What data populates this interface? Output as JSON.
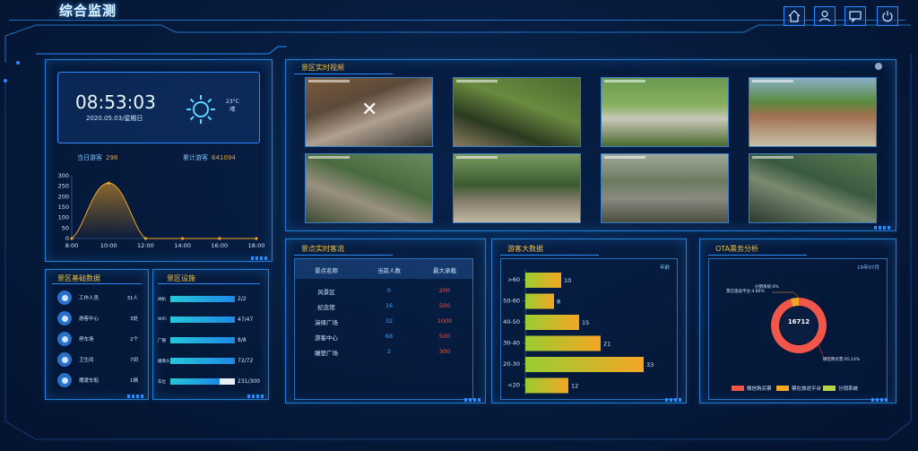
{
  "header": {
    "title": "综合监测"
  },
  "toolbar": {
    "buttons": [
      "home-icon",
      "user-icon",
      "message-icon",
      "power-icon"
    ]
  },
  "clock": {
    "time": "08:53:03",
    "date": "2020.05.03/星期日",
    "temp": "23°C",
    "weather": "晴"
  },
  "visitors": {
    "today_label": "当日游客",
    "today_value": "298",
    "total_label": "累计游客",
    "total_value": "641094"
  },
  "visitor_chart": {
    "type": "area",
    "x": [
      "8:00",
      "10:00",
      "12:00",
      "14:00",
      "16:00",
      "18:00"
    ],
    "values": [
      0,
      265,
      0,
      0,
      0,
      0
    ],
    "yticks": [
      "300",
      "250",
      "200",
      "150",
      "100",
      "50",
      "0"
    ],
    "ylim": [
      0,
      300
    ]
  },
  "basic_data": {
    "title": "景区基础数据",
    "rows": [
      {
        "label": "工作人员",
        "value": "31人",
        "icon": "staff-icon"
      },
      {
        "label": "游客中心",
        "value": "3处",
        "icon": "visitor-center-icon"
      },
      {
        "label": "停车场",
        "value": "2个",
        "icon": "parking-icon"
      },
      {
        "label": "卫生间",
        "value": "7间",
        "icon": "toilet-icon"
      },
      {
        "label": "摆渡车船",
        "value": "1辆",
        "icon": "shuttle-icon"
      }
    ]
  },
  "facilities": {
    "title": "景区设施",
    "rows": [
      {
        "label": "闸机",
        "value": "2/2",
        "ratio": 1.0
      },
      {
        "label": "WIFI",
        "value": "47/47",
        "ratio": 1.0
      },
      {
        "label": "广播",
        "value": "8/8",
        "ratio": 1.0
      },
      {
        "label": "摄像头",
        "value": "72/72",
        "ratio": 1.0
      },
      {
        "label": "车位",
        "value": "231/300",
        "ratio": 0.77
      }
    ]
  },
  "video": {
    "title": "景区实时视频"
  },
  "flow": {
    "title": "景点实时客流",
    "headers": [
      "景点名称",
      "当前人数",
      "最大承载"
    ],
    "rows": [
      {
        "name": "风景区",
        "current": "0",
        "max": "200"
      },
      {
        "name": "纪念馆",
        "current": "16",
        "max": "500"
      },
      {
        "name": "演绎广场",
        "current": "32",
        "max": "1000"
      },
      {
        "name": "游客中心",
        "current": "68",
        "max": "500"
      },
      {
        "name": "雕塑广场",
        "current": "2",
        "max": "300"
      }
    ]
  },
  "age": {
    "title": "游客大数据",
    "unit": "年龄",
    "chart_data": {
      "type": "bar",
      "categories": [
        ">60",
        "50-60",
        "40-50",
        "30-40",
        "20-30",
        "<20"
      ],
      "values": [
        10,
        8,
        15,
        21,
        33,
        12
      ],
      "xlim": [
        0,
        40
      ]
    }
  },
  "ota": {
    "title": "OTA票务分析",
    "period": "19年07月",
    "total": "16712",
    "labels": {
      "a": "分销系统:0%",
      "b": "票在旅途平台:4.86%",
      "c": "微信购买票:95.14%"
    },
    "chart_data": {
      "type": "pie",
      "categories": [
        "微信购买票",
        "票在旅途平台",
        "分销系统"
      ],
      "values": [
        95.14,
        4.86,
        0
      ]
    },
    "legend": [
      "微信购买票",
      "票在旅途平台",
      "分销系统"
    ],
    "colors": [
      "#f0574a",
      "#f5a623",
      "#b5d34a"
    ]
  }
}
